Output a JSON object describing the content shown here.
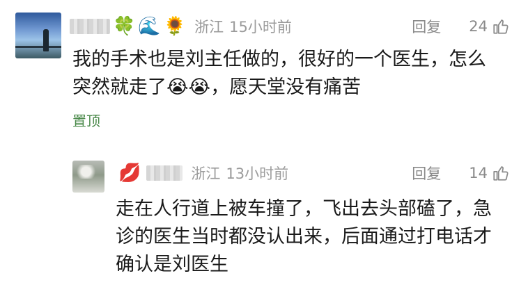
{
  "comments": [
    {
      "emojis": [
        "🍀",
        "🌊",
        "🌻"
      ],
      "location": "浙江",
      "time": "15小时前",
      "reply_label": "回复",
      "likes": "24",
      "text": "我的手术也是刘主任做的，很好的一个医生，怎么突然就走了😭😭，愿天堂没有痛苦",
      "pinned_label": "置顶"
    },
    {
      "emojis": [
        "💋"
      ],
      "location": "浙江",
      "time": "13小时前",
      "reply_label": "回复",
      "likes": "14",
      "text": "走在人行道上被车撞了，飞出去头部磕了，急诊的医生当时都没认出来，后面通过打电话才确认是刘医生"
    }
  ],
  "colors": {
    "meta_gray": "#9b9b9b",
    "pinned_green": "#4b8a4b",
    "text": "#1a1a1a"
  },
  "icons": [
    "thumbs-up-icon"
  ]
}
